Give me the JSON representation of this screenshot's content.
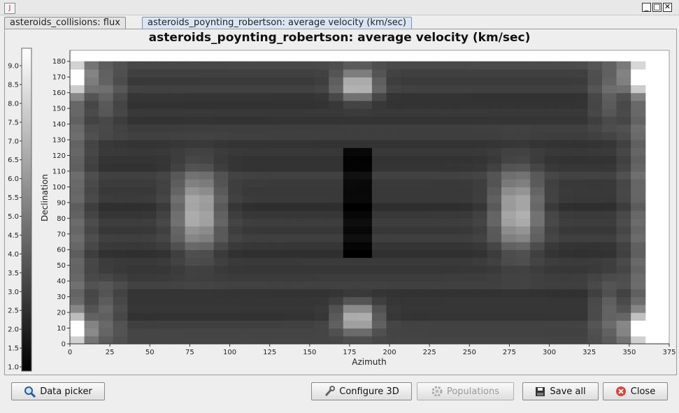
{
  "window": {
    "icon_glyph": "J",
    "minimize_glyph": "_",
    "maximize_glyph": "□",
    "close_glyph": "✕"
  },
  "tabs": [
    {
      "label": "asteroids_collisions: flux",
      "active": false
    },
    {
      "label": "asteroids_poynting_robertson: average velocity (km/sec)",
      "active": true
    }
  ],
  "buttons": {
    "data_picker": "Data picker",
    "configure_3d": "Configure 3D",
    "populations": "Populations",
    "save_all": "Save all",
    "close": "Close"
  },
  "icons": {
    "data_picker": "magnifier-icon",
    "configure_3d": "wrench-icon",
    "populations": "gear-icon",
    "save_all": "floppy-disk-icon",
    "close": "close-circle-icon"
  },
  "colors": {
    "close_icon": "#d9433b",
    "active_tab": "#dbe6f5"
  },
  "chart_data": {
    "type": "heatmap",
    "title": "asteroids_poynting_robertson: average velocity (km/sec)",
    "xlabel": "Azimuth",
    "ylabel": "Declination",
    "xlim": [
      0,
      375
    ],
    "ylim": [
      0,
      187
    ],
    "x_ticks": [
      0,
      25,
      50,
      75,
      100,
      125,
      150,
      175,
      200,
      225,
      250,
      275,
      300,
      325,
      350,
      375
    ],
    "y_ticks": [
      0,
      10,
      20,
      30,
      40,
      50,
      60,
      70,
      80,
      90,
      100,
      110,
      120,
      130,
      140,
      150,
      160,
      170,
      180
    ],
    "data_x_range": [
      0,
      360
    ],
    "data_y_range": [
      0,
      180
    ],
    "colorbar": {
      "min": 1.0,
      "max": 9.0,
      "ticks": [
        "1.0",
        "1.5",
        "2.0",
        "2.5",
        "3.0",
        "3.5",
        "4.0",
        "4.5",
        "5.0",
        "5.5",
        "6.0",
        "6.5",
        "7.0",
        "7.5",
        "8.0",
        "8.5",
        "9.0"
      ],
      "colormap": "grayscale"
    },
    "grid": false
  }
}
